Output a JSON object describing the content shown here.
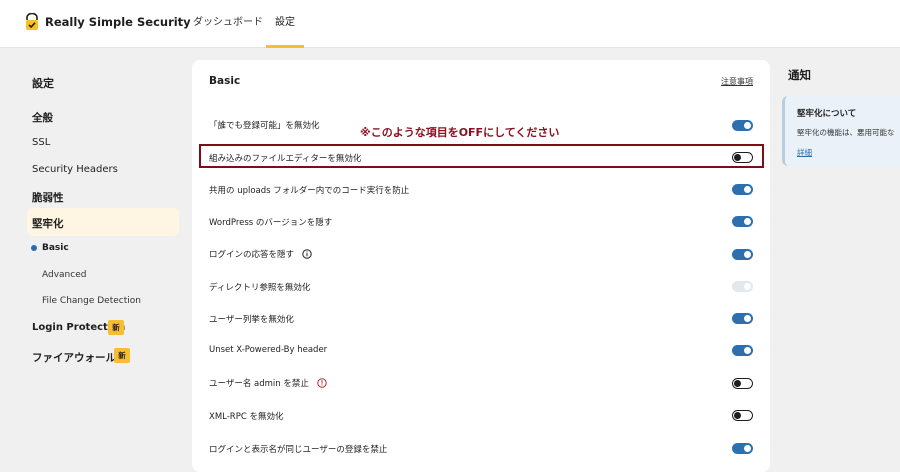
{
  "header": {
    "app_name": "Really Simple Security",
    "tabs": [
      {
        "label": "ダッシュボード",
        "active": false
      },
      {
        "label": "設定",
        "active": true
      }
    ],
    "accent_color": "#f8be2e"
  },
  "sidebar": {
    "heading": "設定",
    "items": [
      {
        "label": "全般"
      },
      {
        "label": "SSL"
      },
      {
        "label": "Security Headers"
      },
      {
        "label": "脆弱性"
      },
      {
        "label": "堅牢化",
        "active": true
      }
    ],
    "sub_items": [
      {
        "label": "Basic",
        "active": true
      },
      {
        "label": "Advanced"
      },
      {
        "label": "File Change Detection"
      }
    ],
    "extra_items": [
      {
        "label": "Login Protection",
        "badge": "新"
      },
      {
        "label": "ファイアウォール",
        "badge": "新"
      }
    ]
  },
  "main": {
    "title": "Basic",
    "link": "注意事項",
    "annotation": "※このような項目をOFFにしてください",
    "rows": [
      {
        "label": "「誰でも登録可能」を無効化",
        "state": "on"
      },
      {
        "label": "組み込みのファイルエディターを無効化",
        "state": "off",
        "highlighted": true
      },
      {
        "label": "共用の uploads フォルダー内でのコード実行を防止",
        "state": "on"
      },
      {
        "label": "WordPress のバージョンを隠す",
        "state": "on"
      },
      {
        "label": "ログインの応答を隠す",
        "state": "on",
        "icon": "info-icon"
      },
      {
        "label": "ディレクトリ参照を無効化",
        "state": "disabled"
      },
      {
        "label": "ユーザー列挙を無効化",
        "state": "on"
      },
      {
        "label": "Unset X-Powered-By header",
        "state": "on"
      },
      {
        "label": "ユーザー名 admin を禁止",
        "state": "off",
        "icon": "warning-icon"
      },
      {
        "label": "XML-RPC を無効化",
        "state": "off"
      },
      {
        "label": "ログインと表示名が同じユーザーの登録を禁止",
        "state": "on"
      }
    ]
  },
  "right_panel": {
    "title": "通知",
    "notice": {
      "title": "堅牢化について",
      "text": "堅牢化の機能は、悪用可能な",
      "link": "詳細"
    }
  }
}
